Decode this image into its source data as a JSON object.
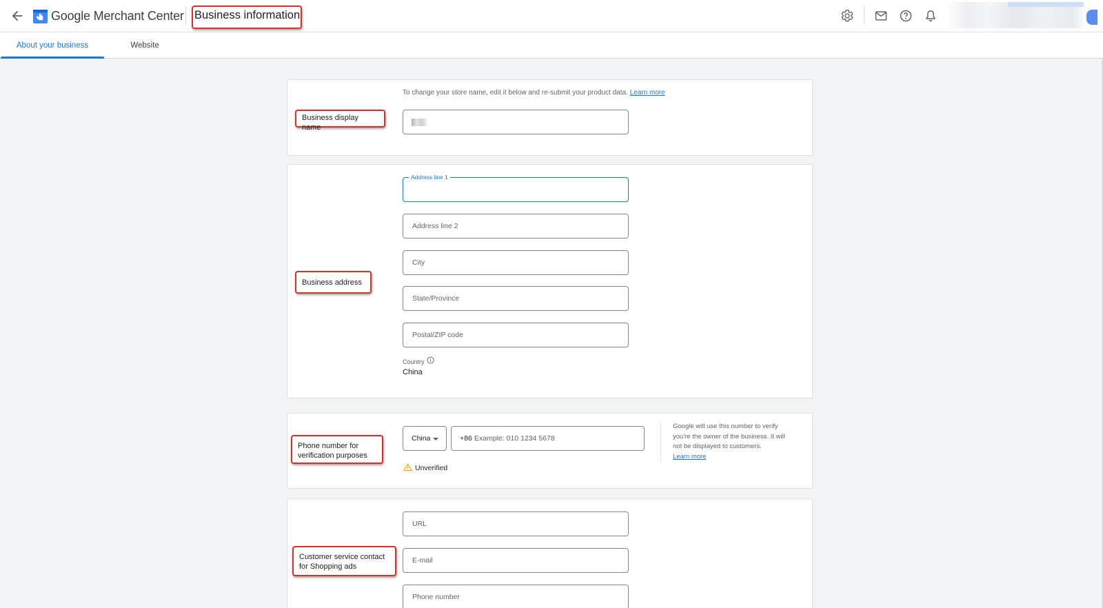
{
  "header": {
    "product_name": "Google Merchant Center",
    "page_title": "Business information",
    "icons": [
      "back-arrow-icon",
      "merchant-center-logo-icon",
      "settings-gear-icon",
      "mail-icon",
      "help-icon",
      "notifications-bell-icon"
    ]
  },
  "tabs": [
    {
      "label": "About your business",
      "active": true
    },
    {
      "label": "Website",
      "active": false
    }
  ],
  "sections": {
    "display_name": {
      "label": "Business display name",
      "hint": "To change your store name, edit it below and re-submit your product data.",
      "hint_link": "Learn more"
    },
    "address": {
      "label": "Business address",
      "line1_label": "Address line 1",
      "line2_placeholder": "Address line 2",
      "city_placeholder": "City",
      "state_placeholder": "State/Province",
      "postal_placeholder": "Postal/ZIP code",
      "country_label": "Country",
      "country_value": "China"
    },
    "phone": {
      "label_line1": "Phone number for",
      "label_line2": "verification purposes",
      "country_select": "China",
      "prefix": "+86",
      "placeholder": "Example: 010 1234 5678",
      "status": "Unverified",
      "note_line1": "Google will use this number to verify",
      "note_line2": "you're the owner of the business. It will",
      "note_line3": "not be displayed to customers.",
      "note_link": "Learn more"
    },
    "customer_service": {
      "label_line1": "Customer service contact",
      "label_line2": "for Shopping ads",
      "url_placeholder": "URL",
      "email_placeholder": "E-mail",
      "phone_placeholder": "Phone number"
    }
  },
  "colors": {
    "accent": "#1a73e8",
    "annotation_red": "#d93025",
    "warning": "#f9ab00",
    "page_bg": "#f1f3f4"
  }
}
